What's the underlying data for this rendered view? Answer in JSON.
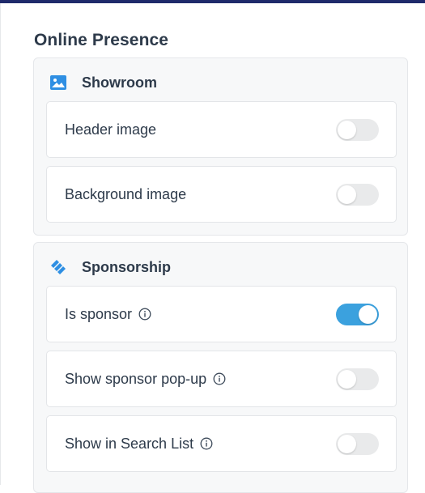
{
  "section": {
    "title": "Online Presence"
  },
  "showroom": {
    "title": "Showroom",
    "icon": "image-icon",
    "rows": [
      {
        "label": "Header image",
        "enabled": false,
        "info": false
      },
      {
        "label": "Background image",
        "enabled": false,
        "info": false
      }
    ]
  },
  "sponsorship": {
    "title": "Sponsorship",
    "icon": "handshake-icon",
    "rows": [
      {
        "label": "Is sponsor",
        "enabled": true,
        "info": true
      },
      {
        "label": "Show sponsor pop-up",
        "enabled": false,
        "info": true
      },
      {
        "label": "Show in Search List",
        "enabled": false,
        "info": true
      }
    ]
  },
  "colors": {
    "top_bar": "#1f2a6b",
    "toggle_on": "#3ba1de",
    "toggle_off": "#e9eaeb",
    "icon_blue": "#2f8fe3"
  }
}
